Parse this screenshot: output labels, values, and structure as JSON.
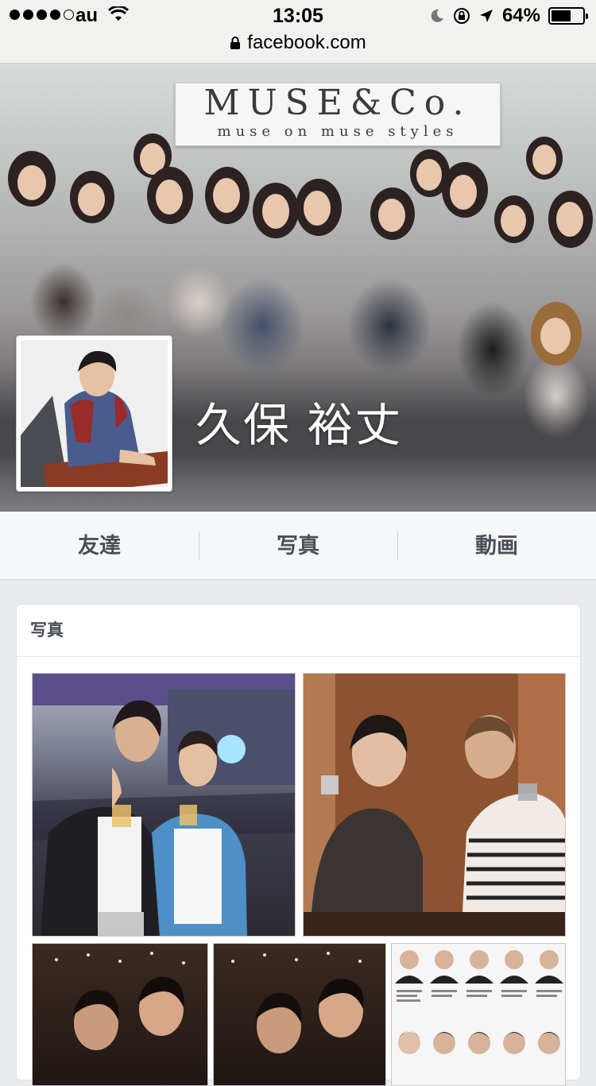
{
  "status_bar": {
    "carrier": "au",
    "time": "13:05",
    "battery_percent": "64%",
    "battery_level": 0.64
  },
  "url_bar": {
    "domain": "facebook.com"
  },
  "cover": {
    "banner_title": "MUSE&Co.",
    "banner_subtitle": "muse on muse styles"
  },
  "profile": {
    "name": "久保 裕丈"
  },
  "nav": {
    "friends": "友達",
    "photos": "写真",
    "videos": "動画"
  },
  "photos_section": {
    "title": "写真"
  }
}
